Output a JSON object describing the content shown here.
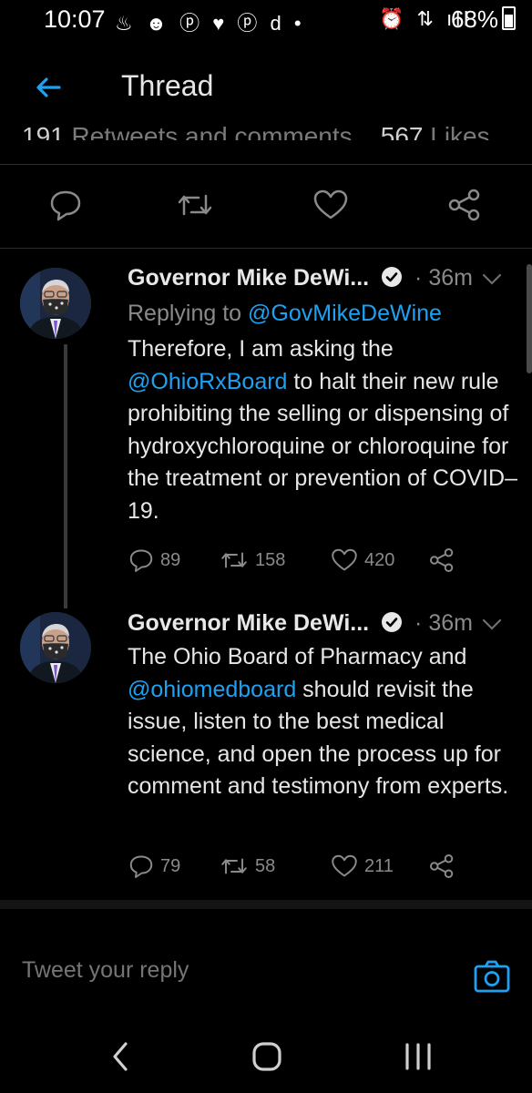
{
  "status_bar": {
    "time": "10:07",
    "battery": "68%"
  },
  "header": {
    "title": "Thread"
  },
  "thread_stats": {
    "retweets_count": "191",
    "retweets_label": "Retweets and comments",
    "likes_count": "567",
    "likes_label": "Likes"
  },
  "tweets": [
    {
      "author": "Governor Mike DeWi...",
      "time": "36m",
      "replying_label": "Replying to",
      "replying_handle": "@GovMikeDeWine",
      "text_1": "Therefore, I am asking the",
      "mention": "@OhioRxBoard",
      "text_2": " to halt their new rule prohibiting the selling or dispensing of hydroxychloroquine or chloroquine for the treatment or prevention of COVID–19.",
      "comments": "89",
      "retweets": "158",
      "likes": "420"
    },
    {
      "author": "Governor Mike DeWi...",
      "time": "36m",
      "text_1": "The Ohio Board of Pharmacy and",
      "mention": "@ohiomedboard",
      "text_2": " should revisit the issue, listen to the best medical science, and open the process up for comment and testimony from experts.",
      "comments": "79",
      "retweets": "58",
      "likes": "211"
    }
  ],
  "reply_bar": {
    "placeholder": "Tweet your reply"
  },
  "colors": {
    "accent": "#1da1f2",
    "background": "#000000",
    "muted": "#8a8a8a"
  }
}
